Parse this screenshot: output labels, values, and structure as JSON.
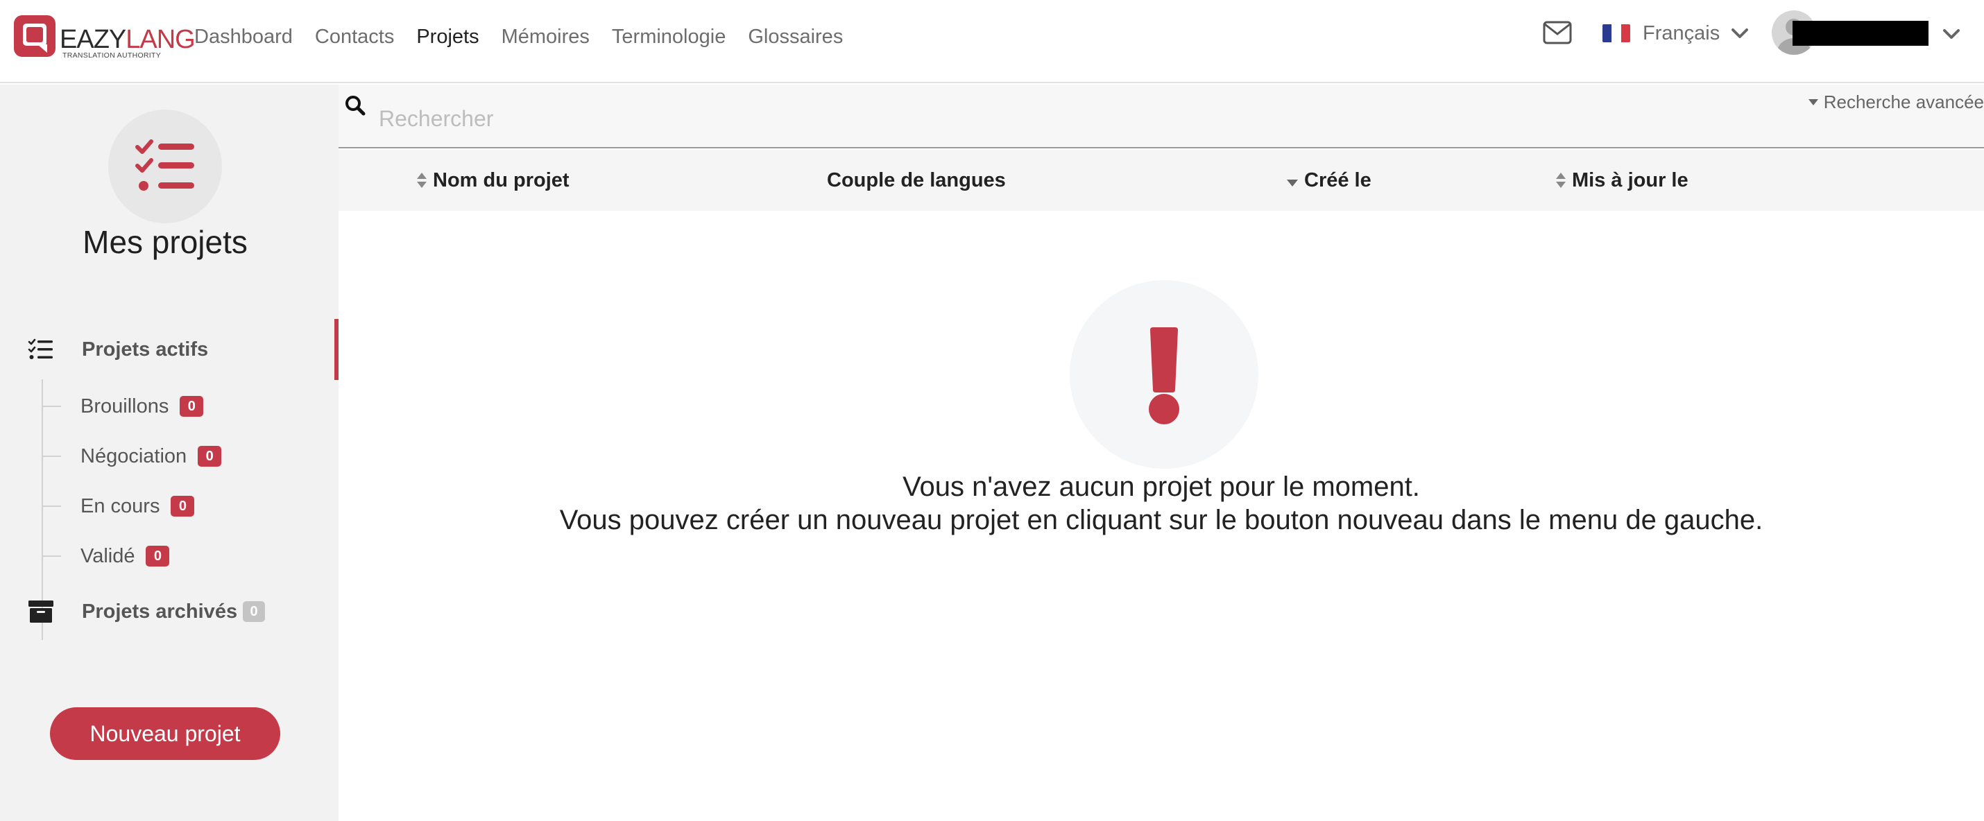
{
  "brand": {
    "name_part1": "EAZY",
    "name_part2": "LANG",
    "tagline": "TRANSLATION AUTHORITY",
    "accent_color": "#c53a48"
  },
  "nav": {
    "items": [
      {
        "label": "Dashboard",
        "active": false
      },
      {
        "label": "Contacts",
        "active": false
      },
      {
        "label": "Projets",
        "active": true
      },
      {
        "label": "Mémoires",
        "active": false
      },
      {
        "label": "Terminologie",
        "active": false
      },
      {
        "label": "Glossaires",
        "active": false
      }
    ]
  },
  "header": {
    "mail_icon": "envelope-icon",
    "language": {
      "label": "Français",
      "flag": "fr-flag-icon"
    },
    "user": {
      "avatar_icon": "user-avatar-icon"
    }
  },
  "sidebar": {
    "title": "Mes projets",
    "title_icon": "checklist-icon",
    "active_projects": {
      "label": "Projets actifs",
      "icon": "checklist-icon"
    },
    "sub_items": [
      {
        "label": "Brouillons",
        "count": "0"
      },
      {
        "label": "Négociation",
        "count": "0"
      },
      {
        "label": "En cours",
        "count": "0"
      },
      {
        "label": "Validé",
        "count": "0"
      }
    ],
    "archived_projects": {
      "label": "Projets archivés",
      "count": "0",
      "icon": "archive-box-icon"
    },
    "new_button": "Nouveau projet"
  },
  "search": {
    "placeholder": "Rechercher",
    "value": "",
    "advanced_label": "Recherche avancée"
  },
  "table": {
    "columns": [
      {
        "label": "Nom du projet",
        "sort": "both"
      },
      {
        "label": "Couple de langues",
        "sort": "none"
      },
      {
        "label": "Créé le",
        "sort": "desc"
      },
      {
        "label": "Mis à jour le",
        "sort": "both"
      }
    ],
    "rows": []
  },
  "empty_state": {
    "icon": "exclamation-icon",
    "line1": "Vous n'avez aucun projet pour le moment.",
    "line2": "Vous pouvez créer un nouveau projet en cliquant sur le bouton nouveau dans le menu de gauche."
  }
}
